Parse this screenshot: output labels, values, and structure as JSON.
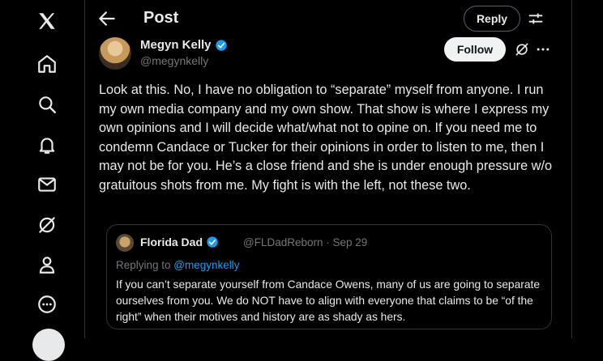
{
  "header": {
    "title": "Post",
    "reply_label": "Reply"
  },
  "post": {
    "author_name": "Megyn Kelly",
    "author_handle": "@megynkelly",
    "follow_label": "Follow",
    "text": "Look at this. No, I have no obligation to “separate” myself from anyone. I run my own media company and my own show. That show is where I express my own opinions and I will decide what/what not to opine on. If you need me to condemn Candace or Tucker for their opinions in order to listen to me, then I may not be for you. He’s a close friend and she is under enough pressure w/o gratuitous shots from me. My fight is with the left, not these two."
  },
  "quote": {
    "author_name": "Florida Dad",
    "author_handle": "@FLDadReborn",
    "date": "Sep 29",
    "meta_separator": " · ",
    "replying_prefix": "Replying to ",
    "replying_mention": "@megynkelly",
    "text": "If you can’t separate yourself from Candace Owens, many of us are going to separate ourselves from you. We do NOT have to align with everyone that claims to be “of the right” when their motives and history are as shady as hers."
  },
  "sidebar": {
    "icons": [
      "x-logo-icon",
      "home-icon",
      "search-icon",
      "notifications-icon",
      "messages-icon",
      "grok-icon",
      "profile-icon",
      "more-icon"
    ]
  },
  "colors": {
    "accent": "#1d9bf0",
    "background": "#000000",
    "border": "#2f3336",
    "muted": "#71767b"
  }
}
